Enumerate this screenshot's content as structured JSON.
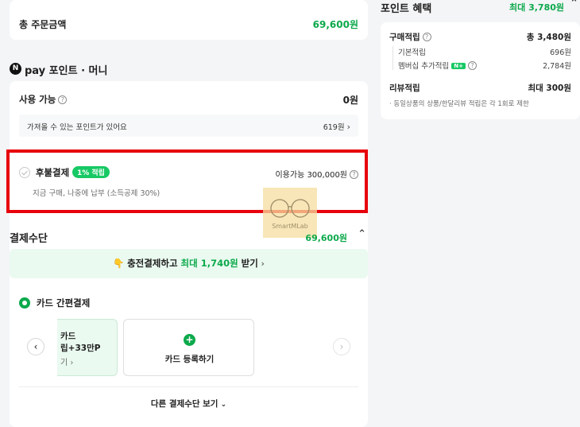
{
  "order_total": {
    "label": "총 주문금액",
    "amount": "69,600원"
  },
  "npay": {
    "logo_letter": "N",
    "title": "pay 포인트 · 머니",
    "usable_label": "사용 가능",
    "usable_amount": "0원",
    "importable_text": "가져올 수 있는 포인트가 있어요",
    "importable_amount": "619원"
  },
  "deferred": {
    "title": "후불결제",
    "badge": "1% 적립",
    "available": "이용가능 300,000원",
    "desc": "지금 구매, 나중에 납부 (소득공제 30%)"
  },
  "watermark": {
    "text": "SmartMLab"
  },
  "payment_method": {
    "title": "결제수단",
    "amount": "69,600원",
    "promo_emoji": "👇",
    "promo_prefix": "충전결제하고 ",
    "promo_highlight": "최대 1,740원",
    "promo_suffix": " 받기",
    "card_pay_label": "카드 간편결제",
    "card_line1": "카드",
    "card_line2": "립+33만P",
    "card_line3": "기",
    "register_card": "카드 등록하기",
    "other_methods": "다른 결제수단 보기"
  },
  "benefits": {
    "title": "포인트 혜택",
    "max": "최대 3,780원",
    "purchase_label": "구매적립",
    "purchase_amount": "총 3,480원",
    "basic_label": "기본적립",
    "basic_amount": "696원",
    "membership_label": "멤버십 추가적립",
    "membership_badge": "N+",
    "membership_amount": "2,784원",
    "review_label": "리뷰적립",
    "review_amount": "최대 300원",
    "note": "· 동일상품의 상품/한달리뷰 적립은 각 1회로 제한"
  },
  "colors": {
    "accent_green": "#0ca94b",
    "highlight_red": "#e8000b",
    "badge_green": "#17c964"
  }
}
